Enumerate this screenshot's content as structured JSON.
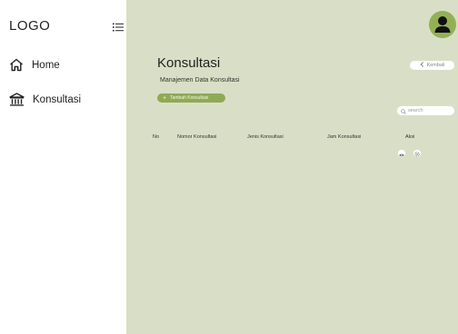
{
  "sidebar": {
    "logo": "LOGO",
    "menu_toggle_icon": "list-icon",
    "items": [
      {
        "label": "Home",
        "icon": "home-icon"
      },
      {
        "label": "Konsultasi",
        "icon": "bank-icon"
      }
    ]
  },
  "header": {
    "avatar_icon": "user-icon",
    "back_label": "Kembali",
    "back_icon": "chevron-left-icon"
  },
  "main": {
    "title": "Konsultasi",
    "subtitle": "Manajemen Data Konsultasi",
    "add_button_label": "Tambah Konsultasi",
    "search_placeholder": "search",
    "table": {
      "columns": [
        "No",
        "Nomor Konsultasi",
        "Jenis Konsultasi",
        "Jam Konsultasi",
        "Aksi"
      ],
      "action_icons": [
        "eye-icon",
        "settings-icon"
      ]
    }
  },
  "colors": {
    "background": "#d9dfc6",
    "sidebar": "#ffffff",
    "accent": "#8faa54",
    "avatar": "#93b154"
  }
}
